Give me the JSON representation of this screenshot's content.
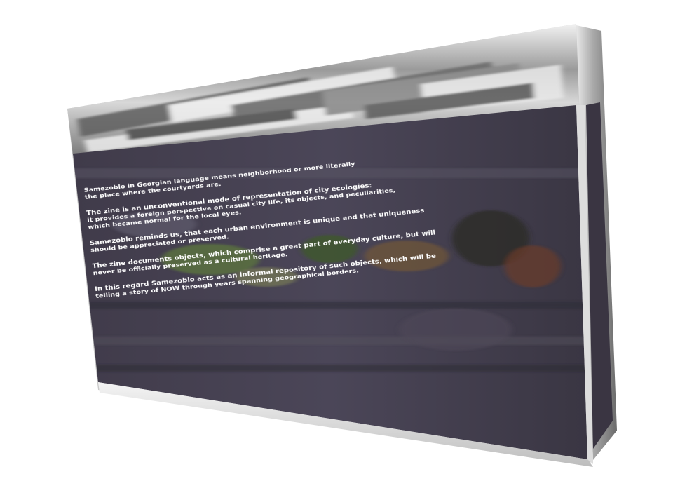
{
  "paragraphs": [
    {
      "lines": [
        "Samezoblo in Georgian language means neighborhood or more literally",
        "the place where the courtyards are."
      ]
    },
    {
      "lines": [
        "The zine is an unconventional mode of representation of city ecologies:",
        "it provides a foreign perspective on casual city life, its objects, and peculiarities,",
        "which became normal for the local eyes."
      ]
    },
    {
      "lines": [
        "Samezoblo reminds us, that each urban environment is unique and that uniqueness",
        "should be appreciated or preserved."
      ]
    },
    {
      "lines": [
        "The zine documents objects, which comprise a great part of everyday culture, but will",
        "never be officially preserved as a cultural heritage."
      ]
    },
    {
      "lines": [
        "In this regard Samezoblo acts as an informal repository of such objects, which will be",
        "telling a story of NOW through years spanning geographical borders."
      ]
    }
  ],
  "colors": {
    "panel_dark": "#3b3845",
    "panel_mid": "#4a4656",
    "frame_light": "#e4e4e4",
    "frame_mid": "#a9a9a9",
    "frame_dark": "#5a5a5a",
    "text": "#ffffff"
  }
}
